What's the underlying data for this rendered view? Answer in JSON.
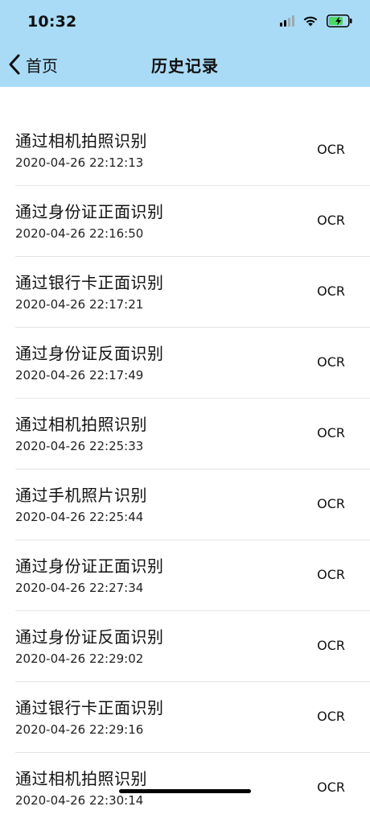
{
  "status_bar": {
    "time": "10:32"
  },
  "nav": {
    "back_label": "首页",
    "title": "历史记录"
  },
  "records": [
    {
      "title": "通过相机拍照识别",
      "time": "2020-04-26 22:12:13",
      "badge": "OCR"
    },
    {
      "title": "通过身份证正面识别",
      "time": "2020-04-26 22:16:50",
      "badge": "OCR"
    },
    {
      "title": "通过银行卡正面识别",
      "time": "2020-04-26 22:17:21",
      "badge": "OCR"
    },
    {
      "title": "通过身份证反面识别",
      "time": "2020-04-26 22:17:49",
      "badge": "OCR"
    },
    {
      "title": "通过相机拍照识别",
      "time": "2020-04-26 22:25:33",
      "badge": "OCR"
    },
    {
      "title": "通过手机照片识别",
      "time": "2020-04-26 22:25:44",
      "badge": "OCR"
    },
    {
      "title": "通过身份证正面识别",
      "time": "2020-04-26 22:27:34",
      "badge": "OCR"
    },
    {
      "title": "通过身份证反面识别",
      "time": "2020-04-26 22:29:02",
      "badge": "OCR"
    },
    {
      "title": "通过银行卡正面识别",
      "time": "2020-04-26 22:29:16",
      "badge": "OCR"
    },
    {
      "title": "通过相机拍照识别",
      "time": "2020-04-26 22:30:14",
      "badge": "OCR"
    }
  ],
  "colors": {
    "nav_bg": "#a9dbf6",
    "battery_fill": "#4cd964",
    "divider": "#e5e5e5"
  },
  "icons": {
    "back": "chevron-left-icon",
    "signal": "cellular-signal-icon",
    "wifi": "wifi-icon",
    "battery": "battery-charging-icon"
  }
}
